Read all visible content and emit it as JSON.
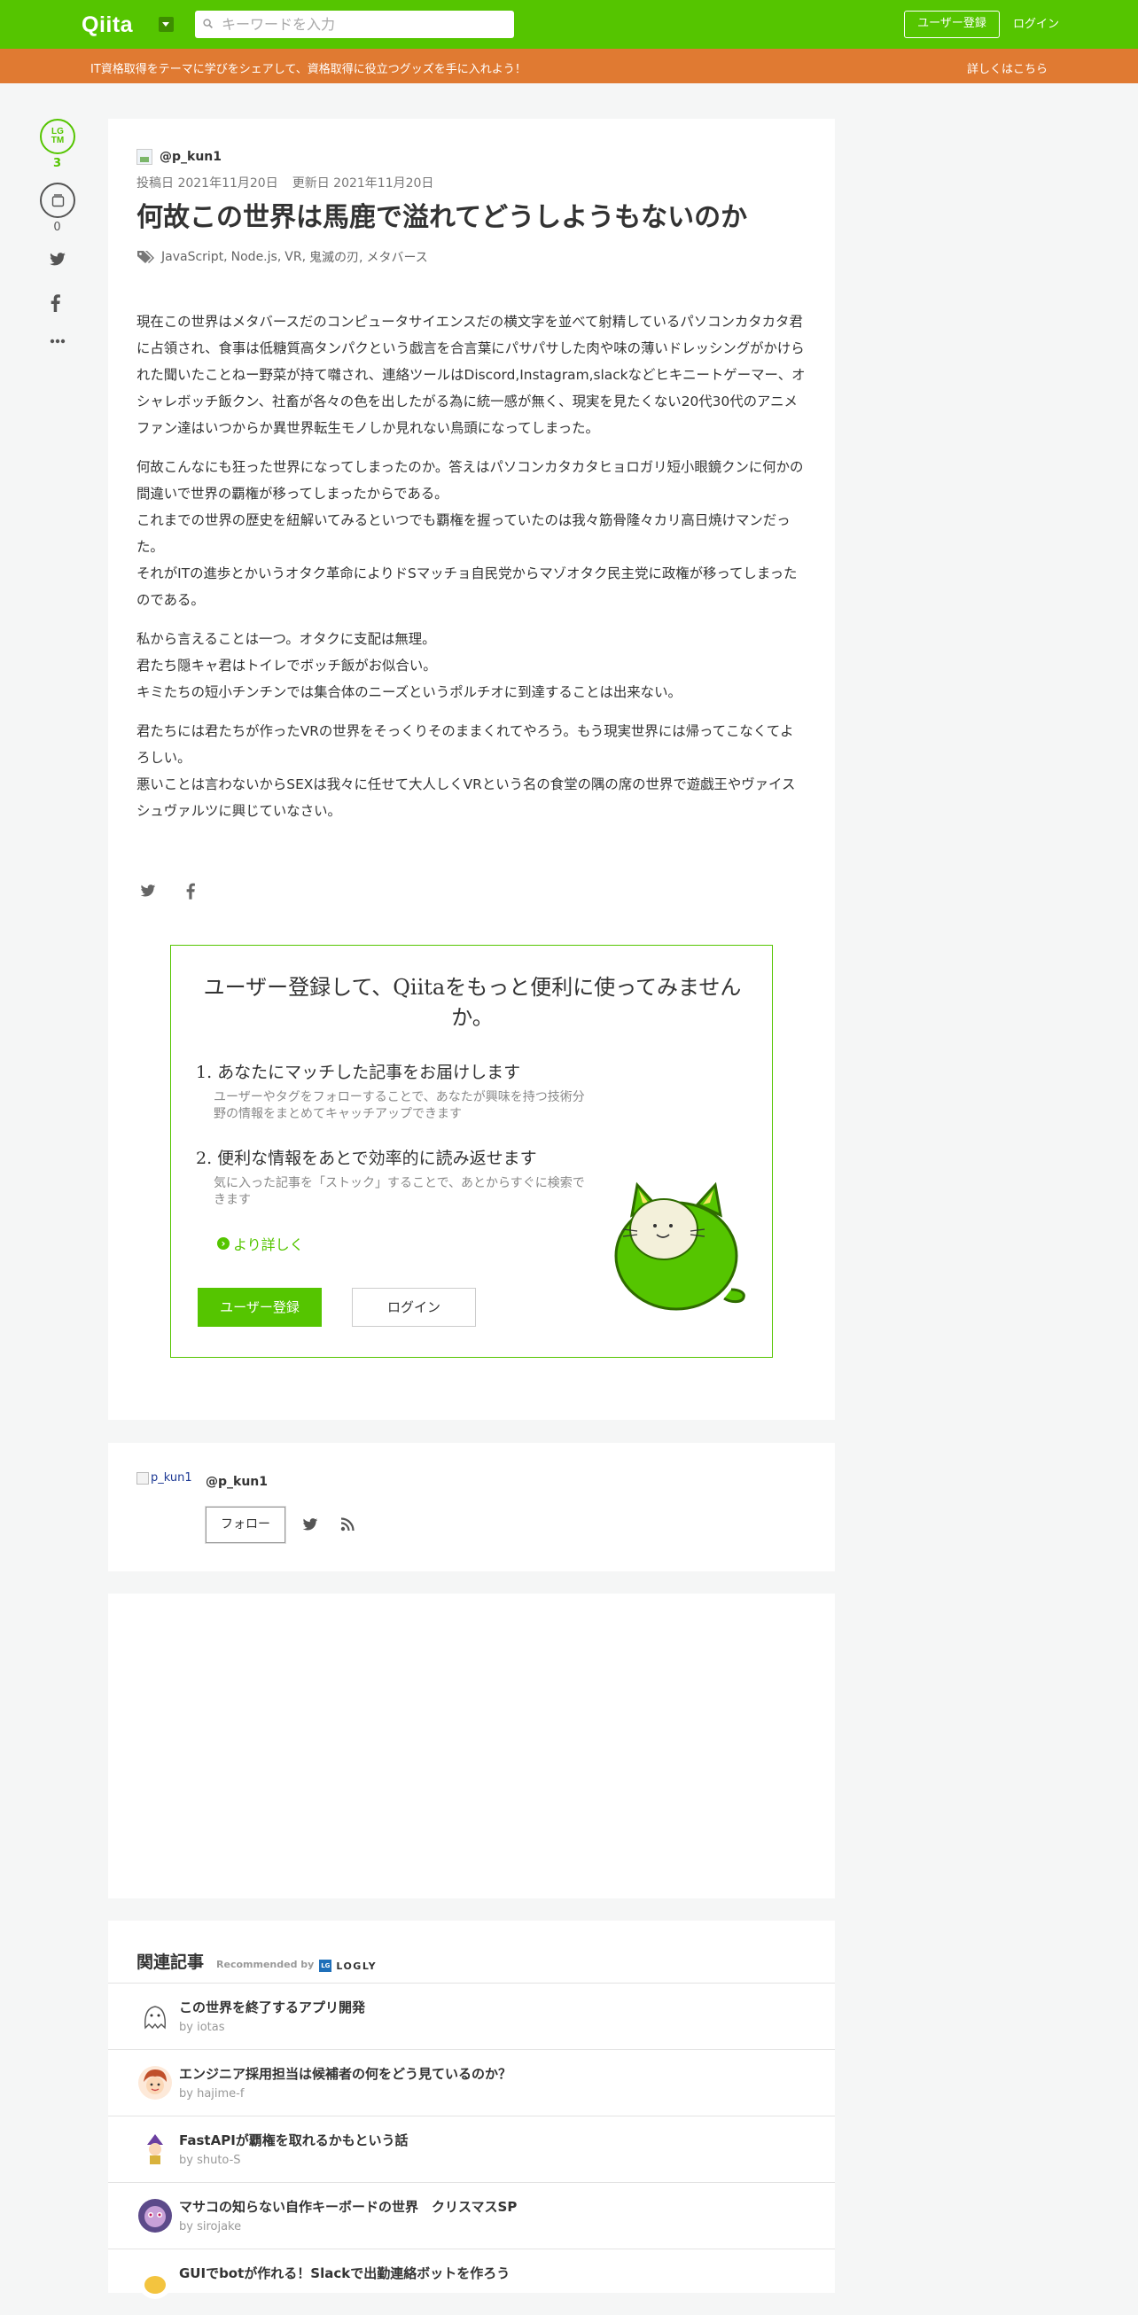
{
  "header": {
    "logo": "Qiita",
    "search_placeholder": "キーワードを入力",
    "signup_label": "ユーザー登録",
    "login_label": "ログイン"
  },
  "promo": {
    "text": "IT資格取得をテーマに学びをシェアして、資格取得に役立つグッズを手に入れよう！",
    "link": "詳しくはこちら"
  },
  "sidebar": {
    "lgtm_line1": "LG",
    "lgtm_line2": "TM",
    "lgtm_count": "3",
    "stock_count": "0"
  },
  "article": {
    "author": "@p_kun1",
    "posted": "投稿日 2021年11月20日",
    "updated": "更新日 2021年11月20日",
    "title": "何故この世界は馬鹿で溢れてどうしようもないのか",
    "tags": [
      "JavaScript,",
      "Node.js,",
      "VR,",
      "鬼滅の刃,",
      "メタバース"
    ],
    "paragraphs": [
      "現在この世界はメタバースだのコンピュータサイエンスだの横文字を並べて射精しているパソコンカタカタ君に占領され、食事は低糖質高タンパクという戯言を合言葉にパサパサした肉や味の薄いドレッシングがかけられた聞いたことねー野菜が持て囃され、連絡ツールはDiscord,Instagram,slackなどヒキニートゲーマー、オシャレボッチ飯クン、社畜が各々の色を出したがる為に統一感が無く、現実を見たくない20代30代のアニメファン達はいつからか異世界転生モノしか見れない鳥頭になってしまった。",
      "何故こんなにも狂った世界になってしまったのか。答えはパソコンカタカタヒョロガリ短小眼鏡クンに何かの間違いで世界の覇権が移ってしまったからである。\nこれまでの世界の歴史を紐解いてみるといつでも覇権を握っていたのは我々筋骨隆々カリ高日焼けマンだった。\nそれがITの進歩とかいうオタク革命によりドSマッチョ自民党からマゾオタク民主党に政権が移ってしまったのである。",
      "私から言えることは一つ。オタクに支配は無理。\n君たち隠キャ君はトイレでボッチ飯がお似合い。\nキミたちの短小チンチンでは集合体のニーズというポルチオに到達することは出来ない。",
      "君たちには君たちが作ったVRの世界をそっくりそのままくれてやろう。もう現実世界には帰ってこなくてよろしい。\n悪いことは言わないからSEXは我々に任せて大人しくVRという名の食堂の隅の席の世界で遊戯王やヴァイスシュヴァルツに興じていなさい。"
    ]
  },
  "signup_box": {
    "heading": "ユーザー登録して、Qiitaをもっと便利に使ってみませんか。",
    "item1_title": "1. あなたにマッチした記事をお届けします",
    "item1_desc": "ユーザーやタグをフォローすることで、あなたが興味を持つ技術分野の情報をまとめてキャッチアップできます",
    "item2_title": "2. 便利な情報をあとで効率的に読み返せます",
    "item2_desc": "気に入った記事を「ストック」することで、あとからすぐに検索できます",
    "more_label": "より詳しく",
    "signup_label": "ユーザー登録",
    "login_label": "ログイン"
  },
  "author_card": {
    "img_alt": "p_kun1",
    "name": "@p_kun1",
    "follow_label": "フォロー"
  },
  "related": {
    "title": "関連記事",
    "recommended_by": "Recommended by",
    "brand": "LOGLY",
    "items": [
      {
        "title": "この世界を終了するアプリ開発",
        "author": "by iotas"
      },
      {
        "title": "エンジニア採用担当は候補者の何をどう見ているのか？",
        "author": "by hajime-f"
      },
      {
        "title": "FastAPIが覇権を取れるかもという話",
        "author": "by shuto-S"
      },
      {
        "title": "マサコの知らない自作キーボードの世界　クリスマスSP",
        "author": "by sirojake"
      },
      {
        "title": "GUIでbotが作れる！Slackで出勤連絡ボットを作ろう",
        "author": ""
      }
    ]
  },
  "colors": {
    "brand_green": "#55c500",
    "promo_orange": "#e07a32"
  }
}
